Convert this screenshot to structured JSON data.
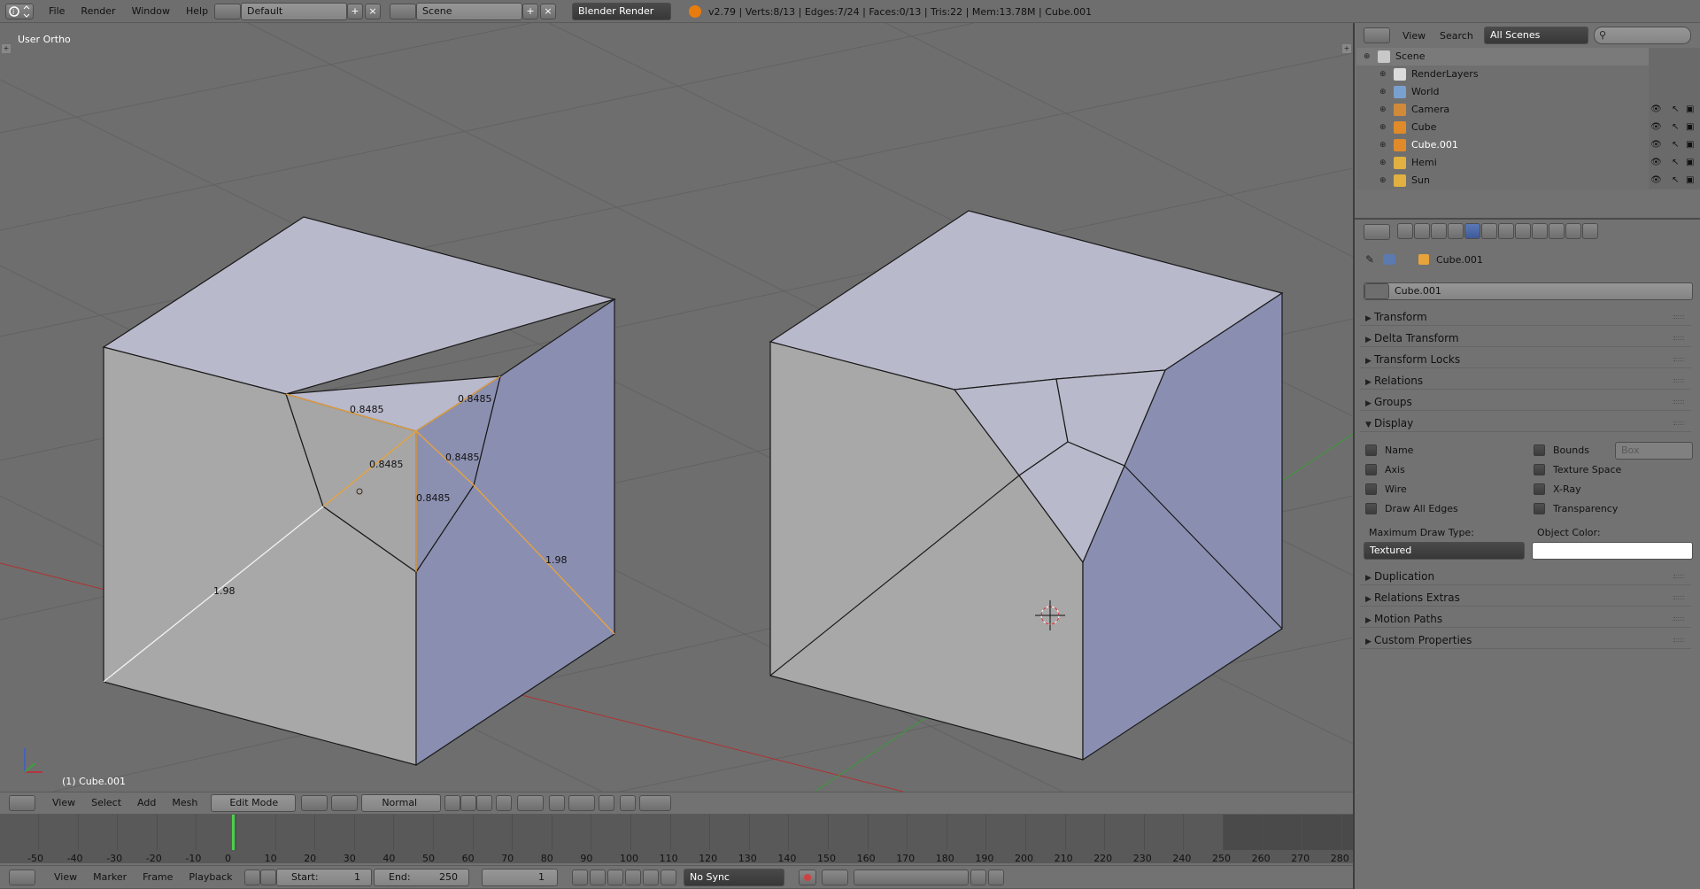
{
  "topbar": {
    "menus": [
      "File",
      "Render",
      "Window",
      "Help"
    ],
    "layout_field": "Default",
    "scene_field": "Scene",
    "engine": "Blender Render",
    "stats": "v2.79 | Verts:8/13 | Edges:7/24 | Faces:0/13 | Tris:22 | Mem:13.78M | Cube.001"
  },
  "viewport": {
    "view_label": "User Ortho",
    "object_label": "(1) Cube.001",
    "measurements": [
      "0.8485",
      "0.8485",
      "0.8485",
      "0.8485",
      "0.8485",
      "1.98",
      "1.98"
    ],
    "header_menus": [
      "View",
      "Select",
      "Add",
      "Mesh"
    ],
    "mode": "Edit Mode",
    "pivot": "Normal",
    "colors": {
      "face_top": "#b8b8cc",
      "face_right": "#8a8fb0",
      "face_left": "#a9a9a9",
      "select_edge": "#e9a23b",
      "grid": "#6a6a6a",
      "background": "#6e6e6e"
    }
  },
  "outliner": {
    "menus": [
      "View",
      "Search"
    ],
    "filter": "All Scenes",
    "items": [
      {
        "label": "Scene",
        "icon": "scene-icon"
      },
      {
        "label": "RenderLayers",
        "icon": "render-layers-icon"
      },
      {
        "label": "World",
        "icon": "world-icon"
      },
      {
        "label": "Camera",
        "icon": "camera-icon"
      },
      {
        "label": "Cube",
        "icon": "mesh-icon"
      },
      {
        "label": "Cube.001",
        "icon": "mesh-icon"
      },
      {
        "label": "Hemi",
        "icon": "lamp-icon"
      },
      {
        "label": "Sun",
        "icon": "lamp-icon"
      }
    ]
  },
  "properties": {
    "breadcrumb": "Cube.001",
    "object_name": "Cube.001",
    "panels_top": [
      "Transform",
      "Delta Transform",
      "Transform Locks",
      "Relations",
      "Groups",
      "Display"
    ],
    "display": {
      "left_checks": [
        "Name",
        "Axis",
        "Wire",
        "Draw All Edges"
      ],
      "right_checks": [
        "Bounds",
        "Texture Space",
        "X-Ray",
        "Transparency"
      ],
      "bounds_value": "Box",
      "max_draw_label": "Maximum Draw Type:",
      "max_draw_value": "Textured",
      "object_color_label": "Object Color:"
    },
    "panels_bottom": [
      "Duplication",
      "Relations Extras",
      "Motion Paths",
      "Custom Properties"
    ]
  },
  "timeline": {
    "ticks": [
      "-50",
      "-40",
      "-30",
      "-20",
      "-10",
      "0",
      "10",
      "20",
      "30",
      "40",
      "50",
      "60",
      "70",
      "80",
      "90",
      "100",
      "110",
      "120",
      "130",
      "140",
      "150",
      "160",
      "170",
      "180",
      "190",
      "200",
      "210",
      "220",
      "230",
      "240",
      "250",
      "260",
      "270",
      "280"
    ],
    "menus": [
      "View",
      "Marker",
      "Frame",
      "Playback"
    ],
    "start_label": "Start:",
    "start_value": "1",
    "end_label": "End:",
    "end_value": "250",
    "current_frame": "1",
    "sync": "No Sync"
  }
}
